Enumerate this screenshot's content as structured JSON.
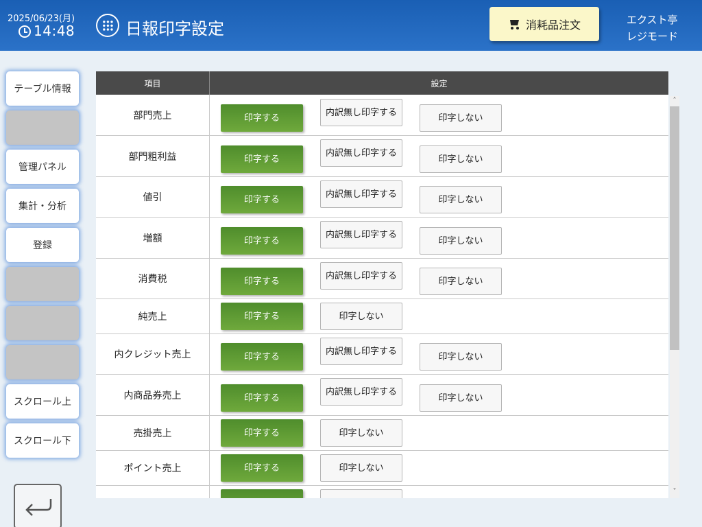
{
  "header": {
    "date": "2025/06/23(月)",
    "time": "14:48",
    "title": "日報印字設定",
    "order_button": "消耗品注文",
    "store_name": "エクスト亭",
    "mode": "レジモード"
  },
  "sidebar": {
    "items": [
      {
        "label": "テーブル情報"
      },
      {
        "label": ""
      },
      {
        "label": "管理パネル"
      },
      {
        "label": "集計・分析"
      },
      {
        "label": "登録"
      },
      {
        "label": ""
      },
      {
        "label": ""
      },
      {
        "label": ""
      },
      {
        "label": "スクロール上"
      },
      {
        "label": "スクロール下"
      }
    ]
  },
  "table": {
    "headers": {
      "item": "項目",
      "setting": "設定"
    },
    "rows": [
      {
        "label": "部門売上",
        "options": [
          "印字する",
          "内訳無し印字する",
          "印字しない"
        ],
        "selected": 0
      },
      {
        "label": "部門粗利益",
        "options": [
          "印字する",
          "内訳無し印字する",
          "印字しない"
        ],
        "selected": 0
      },
      {
        "label": "値引",
        "options": [
          "印字する",
          "内訳無し印字する",
          "印字しない"
        ],
        "selected": 0
      },
      {
        "label": "増額",
        "options": [
          "印字する",
          "内訳無し印字する",
          "印字しない"
        ],
        "selected": 0
      },
      {
        "label": "消費税",
        "options": [
          "印字する",
          "内訳無し印字する",
          "印字しない"
        ],
        "selected": 0
      },
      {
        "label": "純売上",
        "options": [
          "印字する",
          "印字しない"
        ],
        "selected": 0
      },
      {
        "label": "内クレジット売上",
        "options": [
          "印字する",
          "内訳無し印字する",
          "印字しない"
        ],
        "selected": 0
      },
      {
        "label": "内商品券売上",
        "options": [
          "印字する",
          "内訳無し印字する",
          "印字しない"
        ],
        "selected": 0
      },
      {
        "label": "売掛売上",
        "options": [
          "印字する",
          "印字しない"
        ],
        "selected": 0
      },
      {
        "label": "ポイント売上",
        "options": [
          "印字する",
          "印字しない"
        ],
        "selected": 0
      },
      {
        "label": "",
        "options": [
          "",
          ""
        ],
        "selected": 0
      }
    ]
  },
  "colors": {
    "header_bg": "#1a5fb4",
    "selected_green": "#5a9a32",
    "order_button_bg": "#fbf7c9"
  }
}
